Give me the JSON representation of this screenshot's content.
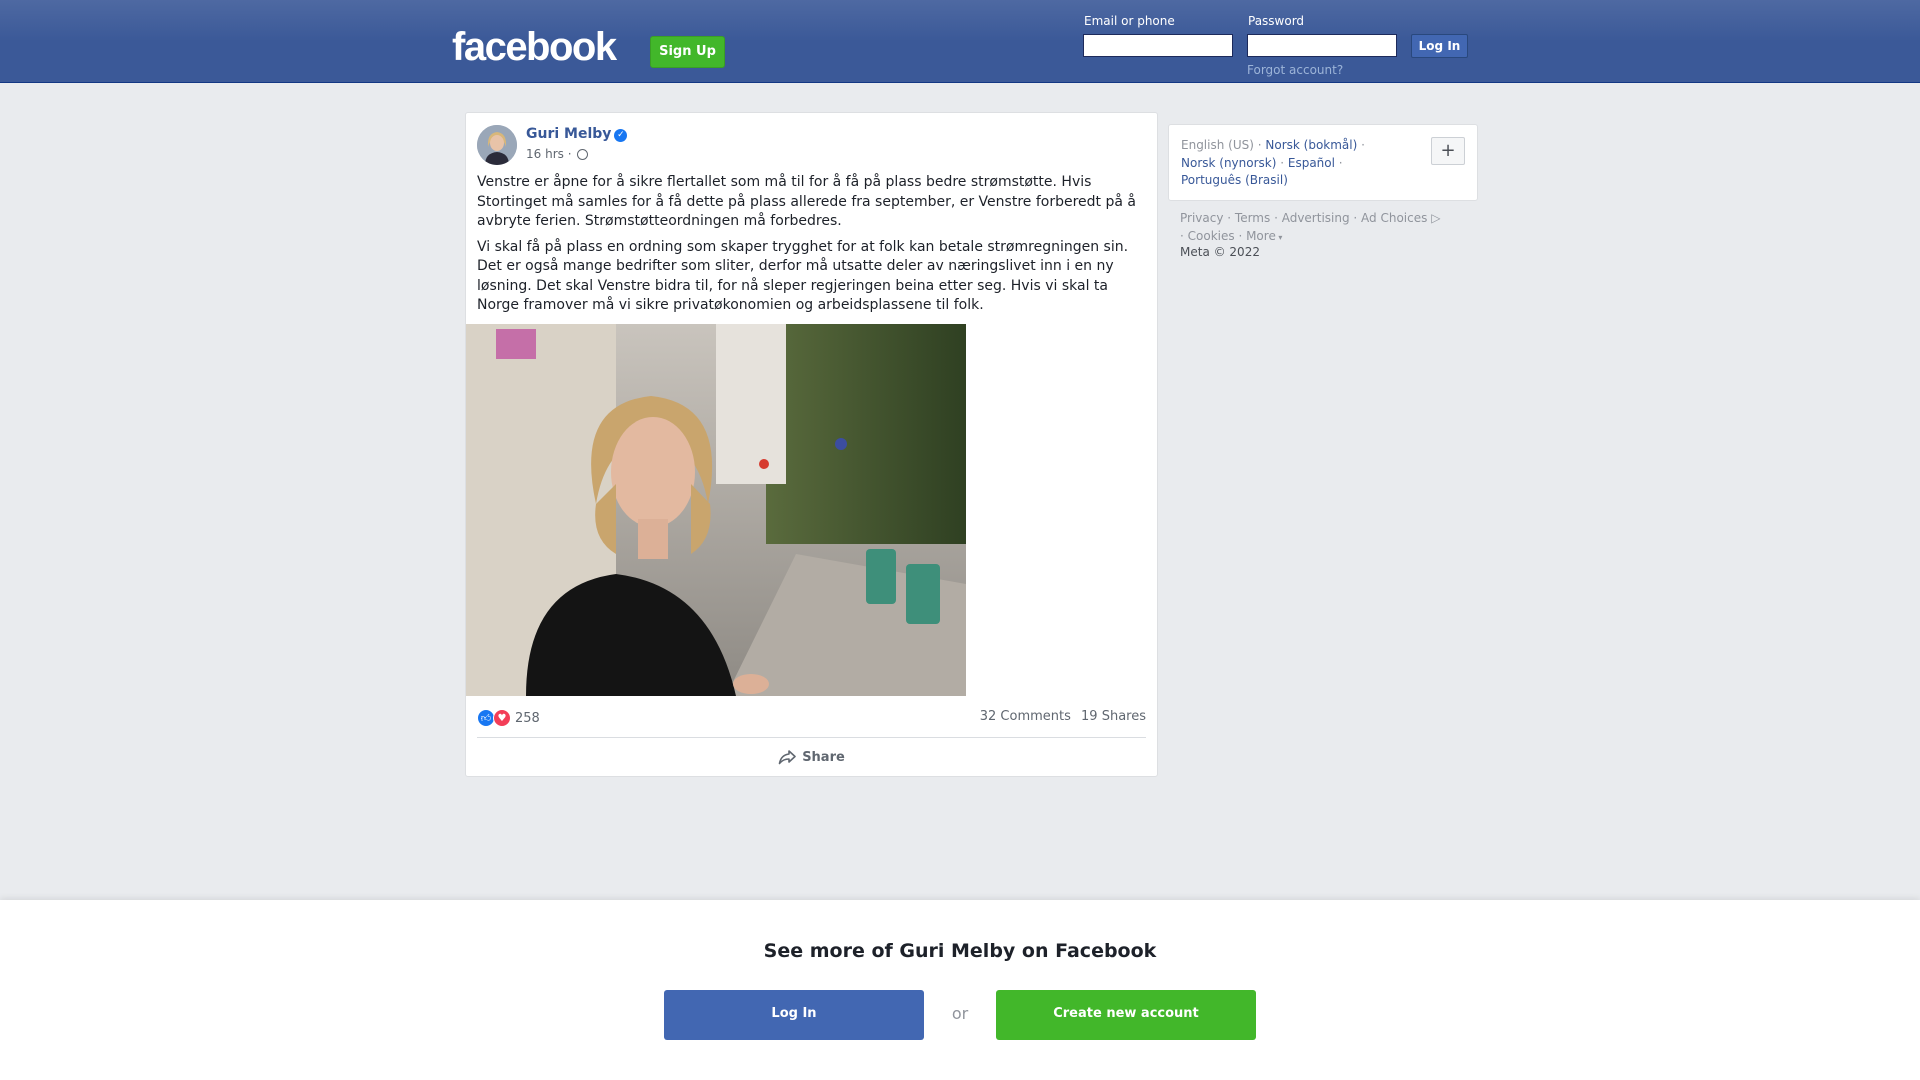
{
  "header": {
    "logo": "facebook",
    "signup_label": "Sign Up",
    "email_label": "Email or phone",
    "password_label": "Password",
    "login_label": "Log In",
    "forgot_label": "Forgot account?"
  },
  "post": {
    "author": "Guri Melby",
    "time": "16 hrs ·",
    "paragraphs": [
      "Venstre er åpne for å sikre flertallet som må til for å få på plass bedre strømstøtte. Hvis Stortinget må samles for å få dette på plass allerede fra september, er Venstre forberedt på å avbryte ferien. Strømstøtteordningen må forbedres.",
      "Vi skal få på plass en ordning som skaper trygghet for at folk kan betale strømregningen sin. Det er også mange bedrifter som sliter, derfor må utsatte deler av næringslivet inn i en ny løsning. Det skal Venstre bidra til, for nå sleper regjeringen beina etter seg. Hvis vi skal ta Norge framover må vi sikre privatøkonomien og arbeidsplassene til folk."
    ],
    "reaction_count": "258",
    "comments": "32 Comments",
    "shares": "19 Shares",
    "share_label": "Share"
  },
  "sidebar": {
    "current_language": "English (US)",
    "languages": [
      "Norsk (bokmål)",
      "Norsk (nynorsk)",
      "Español",
      "Português (Brasil)"
    ],
    "plus_label": "+",
    "footer_links": [
      "Privacy",
      "Terms",
      "Advertising",
      "Ad Choices",
      "Cookies",
      "More"
    ],
    "copyright": "Meta © 2022"
  },
  "bottom": {
    "title": "See more of Guri Melby on Facebook",
    "login_label": "Log In",
    "or_label": "or",
    "create_label": "Create new account"
  },
  "colors": {
    "brand_blue": "#3b5998",
    "button_blue": "#4267b2",
    "green": "#42b72a",
    "link": "#385898"
  }
}
